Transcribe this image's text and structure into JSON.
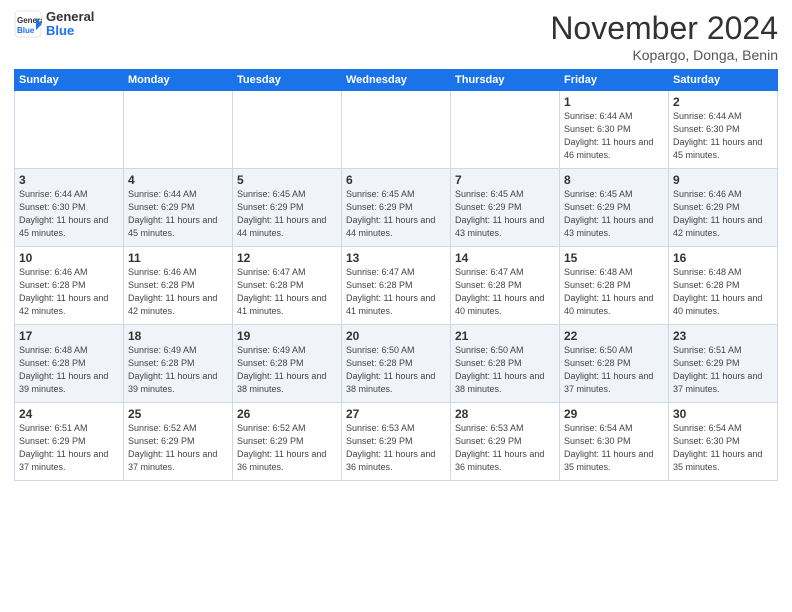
{
  "header": {
    "logo_line1": "General",
    "logo_line2": "Blue",
    "month": "November 2024",
    "location": "Kopargo, Donga, Benin"
  },
  "weekdays": [
    "Sunday",
    "Monday",
    "Tuesday",
    "Wednesday",
    "Thursday",
    "Friday",
    "Saturday"
  ],
  "weeks": [
    [
      {
        "day": "",
        "info": ""
      },
      {
        "day": "",
        "info": ""
      },
      {
        "day": "",
        "info": ""
      },
      {
        "day": "",
        "info": ""
      },
      {
        "day": "",
        "info": ""
      },
      {
        "day": "1",
        "info": "Sunrise: 6:44 AM\nSunset: 6:30 PM\nDaylight: 11 hours and 46 minutes."
      },
      {
        "day": "2",
        "info": "Sunrise: 6:44 AM\nSunset: 6:30 PM\nDaylight: 11 hours and 45 minutes."
      }
    ],
    [
      {
        "day": "3",
        "info": "Sunrise: 6:44 AM\nSunset: 6:30 PM\nDaylight: 11 hours and 45 minutes."
      },
      {
        "day": "4",
        "info": "Sunrise: 6:44 AM\nSunset: 6:29 PM\nDaylight: 11 hours and 45 minutes."
      },
      {
        "day": "5",
        "info": "Sunrise: 6:45 AM\nSunset: 6:29 PM\nDaylight: 11 hours and 44 minutes."
      },
      {
        "day": "6",
        "info": "Sunrise: 6:45 AM\nSunset: 6:29 PM\nDaylight: 11 hours and 44 minutes."
      },
      {
        "day": "7",
        "info": "Sunrise: 6:45 AM\nSunset: 6:29 PM\nDaylight: 11 hours and 43 minutes."
      },
      {
        "day": "8",
        "info": "Sunrise: 6:45 AM\nSunset: 6:29 PM\nDaylight: 11 hours and 43 minutes."
      },
      {
        "day": "9",
        "info": "Sunrise: 6:46 AM\nSunset: 6:29 PM\nDaylight: 11 hours and 42 minutes."
      }
    ],
    [
      {
        "day": "10",
        "info": "Sunrise: 6:46 AM\nSunset: 6:28 PM\nDaylight: 11 hours and 42 minutes."
      },
      {
        "day": "11",
        "info": "Sunrise: 6:46 AM\nSunset: 6:28 PM\nDaylight: 11 hours and 42 minutes."
      },
      {
        "day": "12",
        "info": "Sunrise: 6:47 AM\nSunset: 6:28 PM\nDaylight: 11 hours and 41 minutes."
      },
      {
        "day": "13",
        "info": "Sunrise: 6:47 AM\nSunset: 6:28 PM\nDaylight: 11 hours and 41 minutes."
      },
      {
        "day": "14",
        "info": "Sunrise: 6:47 AM\nSunset: 6:28 PM\nDaylight: 11 hours and 40 minutes."
      },
      {
        "day": "15",
        "info": "Sunrise: 6:48 AM\nSunset: 6:28 PM\nDaylight: 11 hours and 40 minutes."
      },
      {
        "day": "16",
        "info": "Sunrise: 6:48 AM\nSunset: 6:28 PM\nDaylight: 11 hours and 40 minutes."
      }
    ],
    [
      {
        "day": "17",
        "info": "Sunrise: 6:48 AM\nSunset: 6:28 PM\nDaylight: 11 hours and 39 minutes."
      },
      {
        "day": "18",
        "info": "Sunrise: 6:49 AM\nSunset: 6:28 PM\nDaylight: 11 hours and 39 minutes."
      },
      {
        "day": "19",
        "info": "Sunrise: 6:49 AM\nSunset: 6:28 PM\nDaylight: 11 hours and 38 minutes."
      },
      {
        "day": "20",
        "info": "Sunrise: 6:50 AM\nSunset: 6:28 PM\nDaylight: 11 hours and 38 minutes."
      },
      {
        "day": "21",
        "info": "Sunrise: 6:50 AM\nSunset: 6:28 PM\nDaylight: 11 hours and 38 minutes."
      },
      {
        "day": "22",
        "info": "Sunrise: 6:50 AM\nSunset: 6:28 PM\nDaylight: 11 hours and 37 minutes."
      },
      {
        "day": "23",
        "info": "Sunrise: 6:51 AM\nSunset: 6:29 PM\nDaylight: 11 hours and 37 minutes."
      }
    ],
    [
      {
        "day": "24",
        "info": "Sunrise: 6:51 AM\nSunset: 6:29 PM\nDaylight: 11 hours and 37 minutes."
      },
      {
        "day": "25",
        "info": "Sunrise: 6:52 AM\nSunset: 6:29 PM\nDaylight: 11 hours and 37 minutes."
      },
      {
        "day": "26",
        "info": "Sunrise: 6:52 AM\nSunset: 6:29 PM\nDaylight: 11 hours and 36 minutes."
      },
      {
        "day": "27",
        "info": "Sunrise: 6:53 AM\nSunset: 6:29 PM\nDaylight: 11 hours and 36 minutes."
      },
      {
        "day": "28",
        "info": "Sunrise: 6:53 AM\nSunset: 6:29 PM\nDaylight: 11 hours and 36 minutes."
      },
      {
        "day": "29",
        "info": "Sunrise: 6:54 AM\nSunset: 6:30 PM\nDaylight: 11 hours and 35 minutes."
      },
      {
        "day": "30",
        "info": "Sunrise: 6:54 AM\nSunset: 6:30 PM\nDaylight: 11 hours and 35 minutes."
      }
    ]
  ]
}
